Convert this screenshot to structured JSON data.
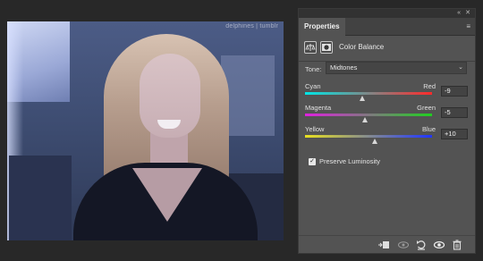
{
  "canvas": {
    "watermark": "delphines | tumblr"
  },
  "panel": {
    "window_controls": [
      "«",
      "✕"
    ],
    "tab_label": "Properties",
    "menu_icon": "≡",
    "adjustment_icons": [
      "color-balance-icon",
      "layer-mask-icon"
    ],
    "adjustment_title": "Color Balance",
    "tone": {
      "label": "Tone:",
      "value": "Midtones"
    },
    "sliders": [
      {
        "left_label": "Cyan",
        "right_label": "Red",
        "value": "-9",
        "numeric": -9,
        "gradient": [
          "#00e5e5",
          "#ff2a2a"
        ]
      },
      {
        "left_label": "Magenta",
        "right_label": "Green",
        "value": "-5",
        "numeric": -5,
        "gradient": [
          "#e020e0",
          "#20d020"
        ]
      },
      {
        "left_label": "Yellow",
        "right_label": "Blue",
        "value": "+10",
        "numeric": 10,
        "gradient": [
          "#e8e020",
          "#2036ff"
        ]
      }
    ],
    "slider_range": [
      -100,
      100
    ],
    "preserve_luminosity": {
      "label": "Preserve Luminosity",
      "checked": true
    },
    "bottom_tools": [
      "clip-to-layer-icon",
      "view-previous-icon",
      "reset-icon",
      "visibility-eye-icon",
      "trash-icon"
    ]
  }
}
